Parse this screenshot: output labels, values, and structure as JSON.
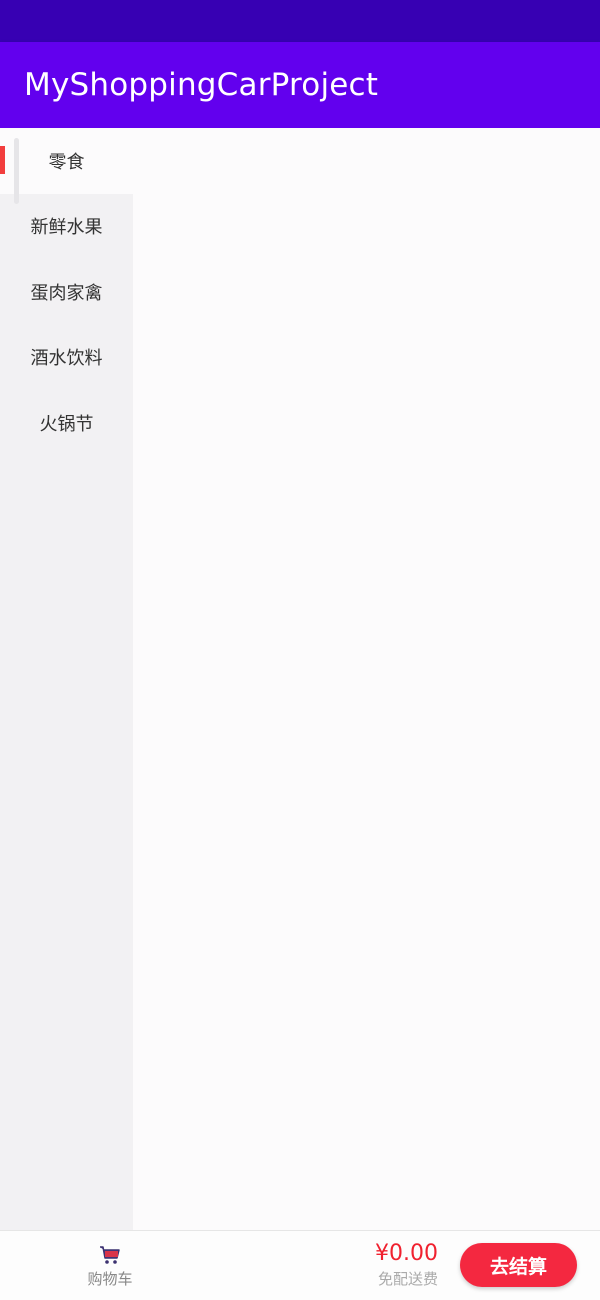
{
  "app": {
    "title": "MyShoppingCarProject"
  },
  "colors": {
    "status_bar": "#3700b3",
    "app_bar": "#6200ee",
    "accent_red": "#f42840",
    "price_red": "#f0212f",
    "sidebar_bg": "#f2f1f3"
  },
  "sidebar": {
    "items": [
      {
        "label": "零食",
        "selected": true
      },
      {
        "label": "新鲜水果",
        "selected": false
      },
      {
        "label": "蛋肉家禽",
        "selected": false
      },
      {
        "label": "酒水饮料",
        "selected": false
      },
      {
        "label": "火锅节",
        "selected": false
      }
    ]
  },
  "bottom_bar": {
    "cart_icon": "shopping-cart-icon",
    "cart_label": "购物车",
    "total_price": "¥0.00",
    "delivery_note": "免配送费",
    "checkout_label": "去结算"
  }
}
